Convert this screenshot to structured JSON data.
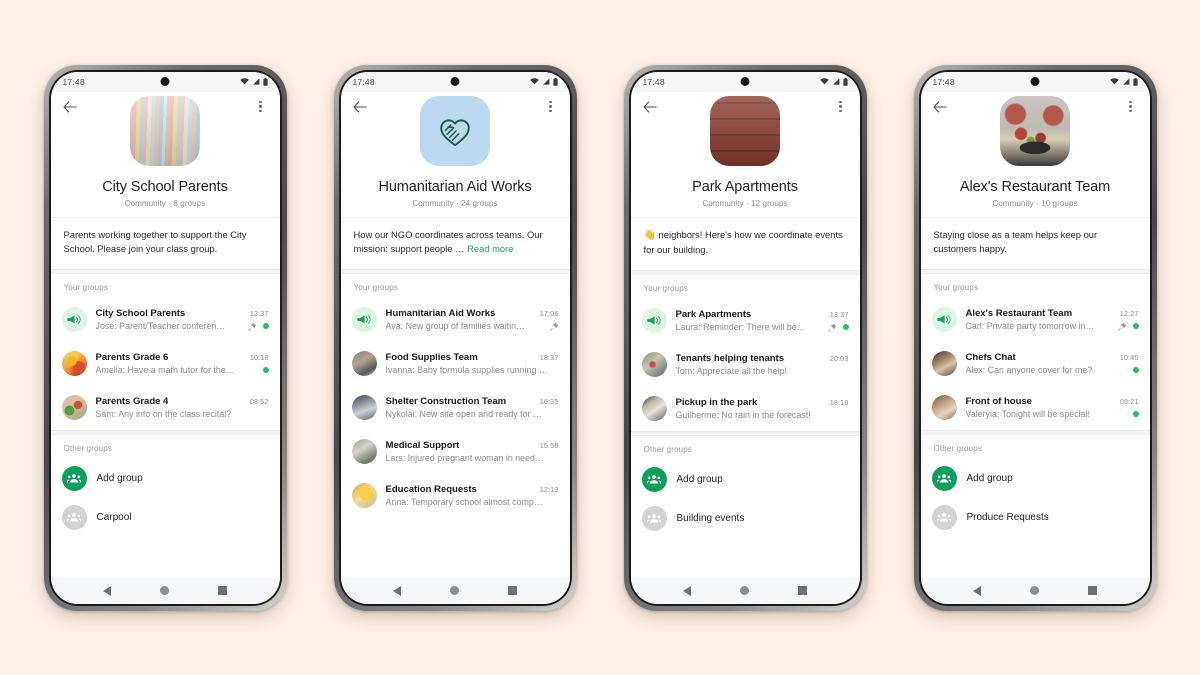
{
  "background_color": "#FCF0E8",
  "accent_color": "#0DA05A",
  "unread_dot_color": "#23C35E",
  "link_color": "#1DA05F",
  "status_bar": {
    "time": "17:48",
    "icons": [
      "wifi-icon",
      "signal-icon",
      "battery-icon"
    ]
  },
  "nav_bar": {
    "back": "nav-back-icon",
    "home": "nav-home-icon",
    "recents": "nav-recents-icon"
  },
  "common": {
    "back_label": "back-arrow-icon",
    "menu_label": "overflow-menu-icon",
    "your_groups_label": "Your groups",
    "other_groups_label": "Other groups",
    "add_group_label": "Add group"
  },
  "phones": [
    {
      "id": "city-school-parents",
      "photo": "books-photo",
      "title": "City School Parents",
      "subtitle": "Community · 8 groups",
      "description": "Parents working together to support the City School. Please join your class group.",
      "description_emoji": "",
      "read_more": "",
      "your_groups_label": "Your groups",
      "groups": [
        {
          "name": "City School Parents",
          "snippet": "José: Parent/Teacher conferen…",
          "time": "12:37",
          "avatar": "announcement-icon",
          "pinned": true,
          "unread": true
        },
        {
          "name": "Parents Grade 6",
          "snippet": "Amelia: Have a math tutor for the…",
          "time": "10:18",
          "avatar": "av-a",
          "pinned": false,
          "unread": true
        },
        {
          "name": "Parents Grade 4",
          "snippet": "Sam: Any info on the class recital?",
          "time": "08:52",
          "avatar": "av-b",
          "pinned": false,
          "unread": false
        }
      ],
      "other_groups_label": "Other groups",
      "other_groups": [
        {
          "label": "Add group",
          "icon": "add-group-icon",
          "style": "green"
        },
        {
          "label": "Carpool",
          "icon": "group-icon",
          "style": "grey"
        }
      ]
    },
    {
      "id": "humanitarian-aid-works",
      "photo": "ngo-logo",
      "title": "Humanitarian Aid Works",
      "subtitle": "Community · 24 groups",
      "description": "How our NGO coordinates across teams. Our mission: support people … ",
      "description_emoji": "",
      "read_more": "Read more",
      "your_groups_label": "Your groups",
      "groups": [
        {
          "name": "Humanitarian Aid Works",
          "snippet": "Ava: New group of families waitin…",
          "time": "17:06",
          "avatar": "announcement-icon",
          "pinned": true,
          "unread": false
        },
        {
          "name": "Food Supplies Team",
          "snippet": "Ivanna: Baby formula supplies running …",
          "time": "18:37",
          "avatar": "av-c",
          "pinned": false,
          "unread": false
        },
        {
          "name": "Shelter Construction Team",
          "snippet": "Nykolai: New site open and ready for …",
          "time": "16:35",
          "avatar": "av-d",
          "pinned": false,
          "unread": false
        },
        {
          "name": "Medical Support",
          "snippet": "Lars: Injured pregnant woman in need…",
          "time": "15:59",
          "avatar": "av-e",
          "pinned": false,
          "unread": false
        },
        {
          "name": "Education Requests",
          "snippet": "Anna: Temporary school almost comp…",
          "time": "12:13",
          "avatar": "av-f",
          "pinned": false,
          "unread": false
        }
      ],
      "other_groups_label": "",
      "other_groups": []
    },
    {
      "id": "park-apartments",
      "photo": "building-photo",
      "title": "Park Apartments",
      "subtitle": "Community · 12 groups",
      "description": " neighbors! Here's how we coordinate events for our building.",
      "description_emoji": "👋",
      "read_more": "",
      "your_groups_label": "Your groups",
      "groups": [
        {
          "name": "Park Apartments",
          "snippet": "Laura: Reminder: There will be…",
          "time": "13:37",
          "avatar": "announcement-icon",
          "pinned": true,
          "unread": true
        },
        {
          "name": "Tenants helping tenants",
          "snippet": "Tom: Appreciate all the help!",
          "time": "20:03",
          "avatar": "av-g",
          "pinned": false,
          "unread": false
        },
        {
          "name": "Pickup in the park",
          "snippet": "Guilherme: No rain in the forecast!",
          "time": "18:18",
          "avatar": "av-h",
          "pinned": false,
          "unread": false
        }
      ],
      "other_groups_label": "Other groups",
      "other_groups": [
        {
          "label": "Add group",
          "icon": "add-group-icon",
          "style": "green"
        },
        {
          "label": "Building events",
          "icon": "group-icon",
          "style": "grey"
        }
      ]
    },
    {
      "id": "alexs-restaurant-team",
      "photo": "food-photo",
      "title": "Alex's Restaurant Team",
      "subtitle": "Community · 10 groups",
      "description": "Staying close as a team helps keep our customers happy.",
      "description_emoji": "",
      "read_more": "",
      "your_groups_label": "Your groups",
      "groups": [
        {
          "name": "Alex's Restaurant Team",
          "snippet": "Carl: Private party tomorrow in…",
          "time": "12:27",
          "avatar": "announcement-icon",
          "pinned": true,
          "unread": true
        },
        {
          "name": "Chefs Chat",
          "snippet": "Alex: Can anyone cover for me?",
          "time": "10:45",
          "avatar": "av-i",
          "pinned": false,
          "unread": true
        },
        {
          "name": "Front of house",
          "snippet": "Valeryia: Tonight will be special!",
          "time": "09:21",
          "avatar": "av-j",
          "pinned": false,
          "unread": true
        }
      ],
      "other_groups_label": "Other groups",
      "other_groups": [
        {
          "label": "Add group",
          "icon": "add-group-icon",
          "style": "green"
        },
        {
          "label": "Produce Requests",
          "icon": "group-icon",
          "style": "grey"
        }
      ]
    }
  ]
}
